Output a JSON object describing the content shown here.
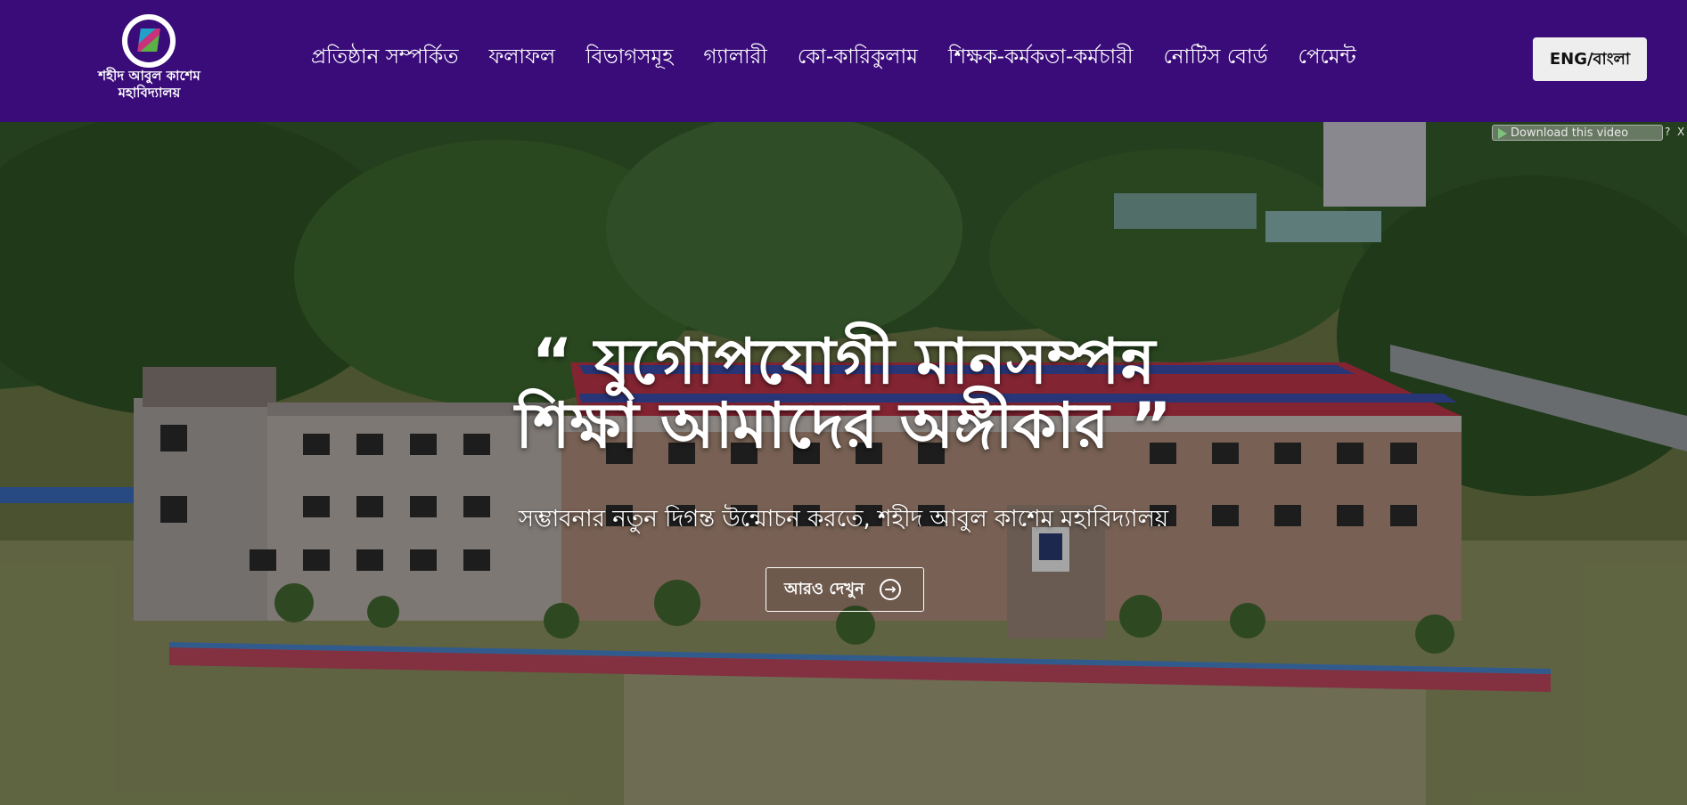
{
  "header": {
    "logo_name_line1": "শহীদ আবুল কাশেম",
    "logo_name_line2": "মহাবিদ্যালয়",
    "nav": [
      {
        "label": "প্রতিষ্ঠান সম্পর্কিত"
      },
      {
        "label": "ফলাফল"
      },
      {
        "label": "বিভাগসমূহ"
      },
      {
        "label": "গ্যালারী"
      },
      {
        "label": "কো-কারিকুলাম"
      },
      {
        "label": "শিক্ষক-কর্মকতা-কর্মচারী"
      },
      {
        "label": "নোটিস বোর্ড"
      },
      {
        "label": "পেমেন্ট"
      }
    ],
    "lang_toggle": "ENG/বাংলা"
  },
  "hero": {
    "headline_line1": "“ যুগোপযোগী মানসম্পন্ন",
    "headline_line2": "শিক্ষা আমাদের অঙ্গীকার ”",
    "subtitle": "সম্ভাবনার নতুন দিগন্ত উন্মোচন করতে, শহীদ আবুল কাশেম মহাবিদ্যালয়",
    "cta_label": "আরও দেখুন",
    "cta_icon": "arrow-right-circle-icon"
  },
  "video_toolbar": {
    "download_label": "Download this video",
    "help_label": "?",
    "close_label": "X"
  },
  "colors": {
    "header_bg": "#3a0c7a",
    "lang_button_bg": "#eeeeee",
    "roof_red": "#c0354a"
  }
}
